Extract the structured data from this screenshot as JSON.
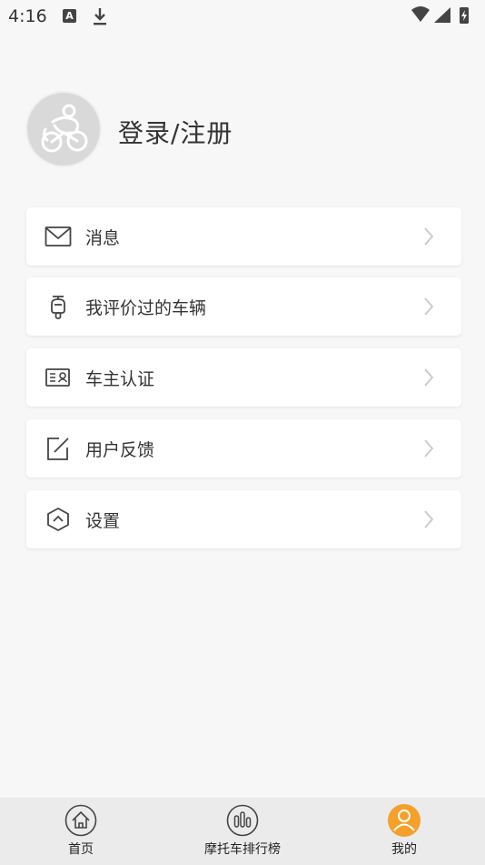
{
  "status_bar": {
    "time": "4:16",
    "notif_letter": "A"
  },
  "profile": {
    "login_label": "登录/注册",
    "avatar_icon": "cyclist-icon"
  },
  "menu": [
    {
      "label": "消息",
      "icon": "mail-icon"
    },
    {
      "label": "我评价过的车辆",
      "icon": "scooter-icon"
    },
    {
      "label": "车主认证",
      "icon": "id-card-icon"
    },
    {
      "label": "用户反馈",
      "icon": "edit-icon"
    },
    {
      "label": "设置",
      "icon": "settings-hexagon-icon"
    }
  ],
  "tabbar": {
    "tabs": [
      {
        "label": "首页",
        "icon": "home-icon"
      },
      {
        "label": "摩托车排行榜",
        "icon": "ranking-bars-icon"
      },
      {
        "label": "我的",
        "icon": "user-icon"
      }
    ],
    "active_index": 2,
    "active_color": "#f5a02a"
  }
}
